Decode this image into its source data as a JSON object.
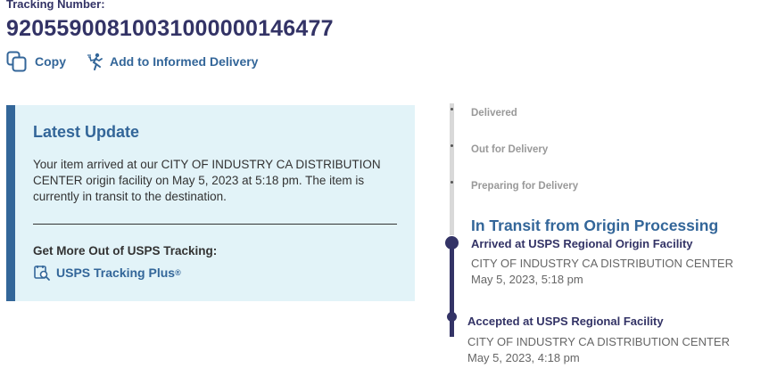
{
  "header": {
    "tracking_label": "Tracking Number:",
    "tracking_number": "9205590081003100000014647​7",
    "copy_label": "Copy",
    "informed_label": "Add to Informed Delivery"
  },
  "latest_update": {
    "title": "Latest Update",
    "body": "Your item arrived at our CITY OF INDUSTRY CA DISTRIBUTION CENTER origin facility on May 5, 2023 at 5:18 pm. The item is currently in transit to the destination.",
    "more_title": "Get More Out of USPS Tracking:",
    "plus_label": "USPS Tracking Plus",
    "plus_mark": "®"
  },
  "timeline": {
    "steps": [
      "Delivered",
      "Out for Delivery",
      "Preparing for Delivery"
    ],
    "current_status": "In Transit from Origin Processing",
    "events": [
      {
        "title": "Arrived at USPS Regional Origin Facility",
        "location": "CITY OF INDUSTRY CA DISTRIBUTION CENTER",
        "time": "May 5, 2023, 5:18 pm"
      },
      {
        "title": "Accepted at USPS Regional Facility",
        "location": "CITY OF INDUSTRY CA DISTRIBUTION CENTER",
        "time": "May 5, 2023, 4:18 pm"
      }
    ]
  },
  "icons": {
    "copy": "copy-icon",
    "informed": "mail-carrier-icon",
    "plus": "tracking-plus-icon"
  },
  "colors": {
    "navy": "#333366",
    "blue": "#336699",
    "card_bg": "#e2f3f8",
    "muted": "#999999"
  }
}
